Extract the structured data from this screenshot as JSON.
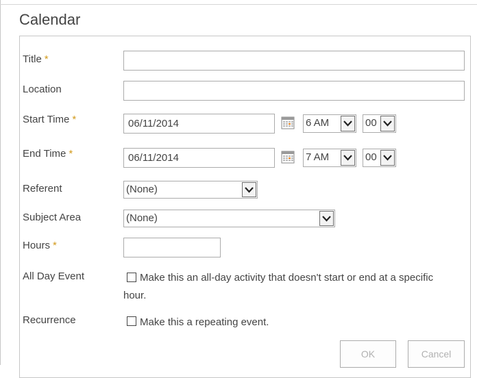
{
  "dialog": {
    "title": "Calendar"
  },
  "required_marker": "*",
  "fields": {
    "title": {
      "label": "Title",
      "value": ""
    },
    "location": {
      "label": "Location",
      "value": ""
    },
    "start_time": {
      "label": "Start Time",
      "date": "06/11/2014",
      "hour": "6 AM",
      "minute": "00"
    },
    "end_time": {
      "label": "End Time",
      "date": "06/11/2014",
      "hour": "7 AM",
      "minute": "00"
    },
    "referent": {
      "label": "Referent",
      "selected": "(None)"
    },
    "subject_area": {
      "label": "Subject Area",
      "selected": "(None)"
    },
    "hours": {
      "label": "Hours",
      "value": ""
    },
    "all_day_event": {
      "label": "All Day Event",
      "checkbox_text_line1": "Make this an all-day activity that doesn't start or end at a specific",
      "checkbox_text_line2": "hour.",
      "checked": false
    },
    "recurrence": {
      "label": "Recurrence",
      "checkbox_text": "Make this a repeating event.",
      "checked": false
    }
  },
  "buttons": {
    "ok_label": "OK",
    "cancel_label": "Cancel"
  },
  "icons": {
    "date_picker": "calendar-icon",
    "dropdown": "chevron-down-icon"
  },
  "colors": {
    "required": "#d29a1c",
    "border": "#ababab",
    "text": "#444444",
    "disabled_text": "#b1b1b1"
  }
}
